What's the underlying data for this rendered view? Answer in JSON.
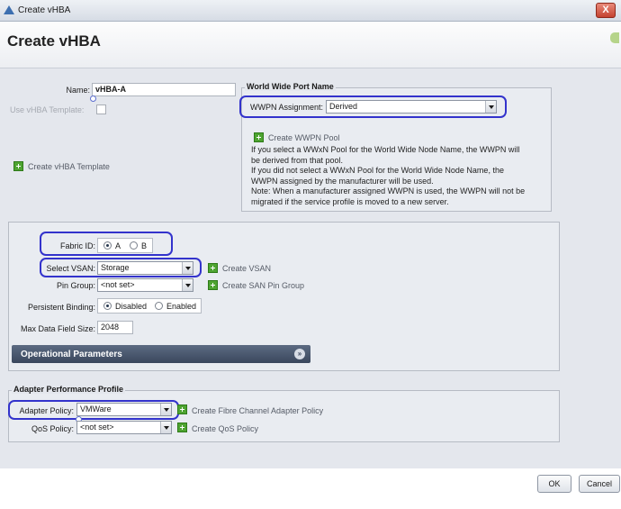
{
  "window": {
    "title": "Create vHBA",
    "close_glyph": "X"
  },
  "header": {
    "page_title": "Create vHBA"
  },
  "form": {
    "name_label": "Name:",
    "name_value": "vHBA-A",
    "use_template_label": "Use vHBA Template:",
    "create_template_link": "Create vHBA Template"
  },
  "wwpn": {
    "group_title": "World Wide Port Name",
    "assignment_label": "WWPN Assignment:",
    "assignment_value": "Derived",
    "create_pool_link": "Create WWPN Pool",
    "note_line1": "If you select a WWxN Pool for the World Wide Node Name, the WWPN will",
    "note_line2": "be derived from that pool.",
    "note_line3": "If you did not select a WWxN Pool for the World Wide Node Name, the",
    "note_line4": "WWPN assigned by the manufacturer will be used.",
    "note_line5": "Note: When a manufacturer assigned WWPN is used, the WWPN will not be",
    "note_line6": "migrated if the service profile is moved to a new server."
  },
  "fabric": {
    "label": "Fabric ID:",
    "option_a": "A",
    "option_b": "B",
    "selected": "A"
  },
  "vsan": {
    "label": "Select VSAN:",
    "value": "Storage",
    "create_link": "Create VSAN"
  },
  "pin_group": {
    "label": "Pin Group:",
    "value": "<not set>",
    "create_link": "Create SAN Pin Group"
  },
  "persistent_binding": {
    "label": "Persistent Binding:",
    "option_disabled": "Disabled",
    "option_enabled": "Enabled",
    "selected": "Disabled"
  },
  "max_data": {
    "label": "Max Data Field Size:",
    "value": "2048"
  },
  "operational": {
    "title": "Operational Parameters",
    "expand_glyph": "»"
  },
  "adapter": {
    "group_title": "Adapter Performance Profile",
    "policy_label": "Adapter Policy:",
    "policy_value": "VMWare",
    "create_policy_link": "Create Fibre Channel Adapter Policy",
    "qos_label": "QoS Policy:",
    "qos_value": "<not set>",
    "create_qos_link": "Create QoS Policy"
  },
  "footer": {
    "ok_label": "OK",
    "cancel_label": "Cancel"
  },
  "colors": {
    "highlight": "#3333cc",
    "plus_icon": "#4ea431",
    "ops_bar": "#4a576d"
  }
}
